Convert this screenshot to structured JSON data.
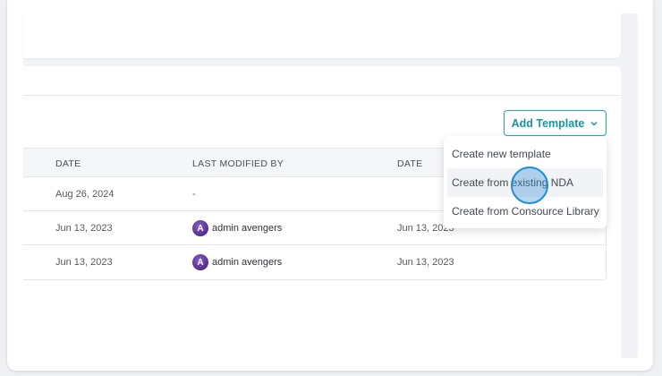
{
  "toolbar": {
    "add_template_label": "Add Template"
  },
  "table": {
    "columns": [
      "DATE",
      "LAST MODIFIED BY",
      "DATE"
    ],
    "rows": [
      {
        "date": "Aug 26, 2024",
        "modified_by": "-",
        "date2": ""
      },
      {
        "date": "Jun 13, 2023",
        "modified_by": "admin avengers",
        "date2": "Jun 13, 2023"
      },
      {
        "date": "Jun 13, 2023",
        "modified_by": "admin avengers",
        "date2": "Jun 13, 2023"
      }
    ]
  },
  "dropdown": {
    "items": [
      "Create new template",
      "Create from existing NDA",
      "Create from Consource Library"
    ]
  },
  "colors": {
    "accent": "#1ea7b6",
    "cursor": "#1e8fd6"
  },
  "icons": {
    "chevron": "chevron-down-icon",
    "avatar": "avengers-avatar-icon"
  }
}
